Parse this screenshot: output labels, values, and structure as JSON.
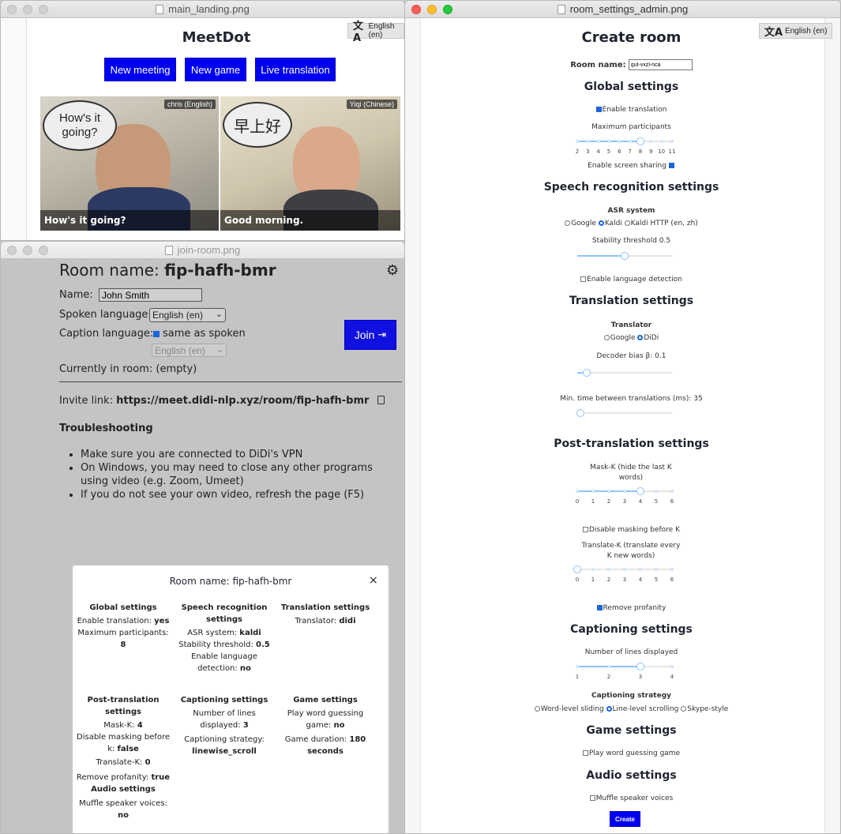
{
  "landing": {
    "file": "main_landing.png",
    "title": "MeetDot",
    "lang": "English (en)",
    "buttons": {
      "new_meeting": "New meeting",
      "new_game": "New game",
      "live_translation": "Live translation"
    },
    "videos": [
      {
        "name_tag": "chris (English)",
        "bubble": "How's it going?",
        "caption": "How's it going?"
      },
      {
        "name_tag": "Yiqi (Chinese)",
        "bubble": "早上好",
        "caption": "Good morning."
      }
    ]
  },
  "join": {
    "file": "join-room.png",
    "room_label": "Room name:",
    "room_name": "fip-hafh-bmr",
    "name_label": "Name:",
    "name_value": "John Smith",
    "spoken_label": "Spoken language:",
    "spoken_value": "English (en)",
    "caption_label": "Caption language:",
    "same_as_spoken": "same as spoken",
    "caption_value": "English (en)",
    "join_label": "Join",
    "currently": "Currently in room: (empty)",
    "invite_label": "Invite link:",
    "invite_url": "https://meet.didi-nlp.xyz/room/fip-hafh-bmr",
    "troubleshooting": "Troubleshooting",
    "tips": [
      "Make sure you are connected to DiDi's VPN",
      "On Windows, you may need to close any other programs using video (e.g. Zoom, Umeet)",
      "If you do not see your own video, refresh the page (F5)"
    ]
  },
  "modal": {
    "title": "Room name: fip-hafh-bmr",
    "global": {
      "heading": "Global settings",
      "enable_translation_label": "Enable translation:",
      "enable_translation": "yes",
      "max_label": "Maximum participants:",
      "max": "8"
    },
    "speech": {
      "heading": "Speech recognition settings",
      "asr_label": "ASR system:",
      "asr": "kaldi",
      "stab_label": "Stability threshold:",
      "stab": "0.5",
      "lang_det_label": "Enable language detection:",
      "lang_det": "no"
    },
    "translation": {
      "heading": "Translation settings",
      "translator_label": "Translator:",
      "translator": "didi"
    },
    "post": {
      "heading": "Post-translation settings",
      "mask_k_label": "Mask-K:",
      "mask_k": "4",
      "disable_label": "Disable masking before k:",
      "disable": "false",
      "tk_label": "Translate-K:",
      "tk": "0",
      "prof_label": "Remove profanity:",
      "prof": "true"
    },
    "audio": {
      "heading": "Audio settings",
      "muffle_label": "Muffle speaker voices:",
      "muffle": "no"
    },
    "caption": {
      "heading": "Captioning settings",
      "lines_label": "Number of lines displayed:",
      "lines": "3",
      "strategy_label": "Captioning strategy:",
      "strategy": "linewise_scroll"
    },
    "game": {
      "heading": "Game settings",
      "play_label": "Play word guessing game:",
      "play": "no",
      "dur_label": "Game duration:",
      "dur": "180 seconds"
    }
  },
  "admin": {
    "file": "room_settings_admin.png",
    "title": "Create room",
    "lang": "English (en)",
    "room_label": "Room name:",
    "room_value": "qut-vxzl-nca",
    "global_h": "Global settings",
    "enable_translation": "Enable translation",
    "max_participants": "Maximum participants",
    "max_ticks": [
      "2",
      "3",
      "4",
      "5",
      "6",
      "7",
      "8",
      "9",
      "10",
      "11"
    ],
    "max_value": 8,
    "screen_sharing": "Enable screen sharing",
    "speech_h": "Speech recognition settings",
    "asr_h": "ASR system",
    "asr_options": [
      "Google",
      "Kaldi",
      "Kaldi HTTP (en, zh)"
    ],
    "stability": "Stability threshold 0.5",
    "stability_value": 0.5,
    "lang_detect": "Enable language detection",
    "translation_h": "Translation settings",
    "translator_h": "Translator",
    "translator_options": [
      "Google",
      "DiDi"
    ],
    "decoder_bias": "Decoder bias β: 0.1",
    "decoder_value": 0.1,
    "min_time": "Min. time between translations (ms): 35",
    "min_time_value": 35,
    "post_h": "Post-translation settings",
    "mask_k": "Mask-K (hide the last K words)",
    "mask_ticks": [
      "0",
      "1",
      "2",
      "3",
      "4",
      "5",
      "6"
    ],
    "mask_value": 4,
    "disable_masking": "Disable masking before K",
    "translate_k": "Translate-K (translate every K new words)",
    "tk_value": 0,
    "remove_profanity": "Remove profanity",
    "caption_h": "Captioning settings",
    "num_lines": "Number of lines displayed",
    "lines_ticks": [
      "1",
      "2",
      "3",
      "4"
    ],
    "lines_value": 3,
    "strategy_h": "Captioning strategy",
    "strategy_options": [
      "Word-level sliding",
      "Line-level scrolling",
      "Skype-style"
    ],
    "game_h": "Game settings",
    "play_game": "Play word guessing game",
    "audio_h": "Audio settings",
    "muffle": "Muffle speaker voices",
    "create": "Create"
  }
}
